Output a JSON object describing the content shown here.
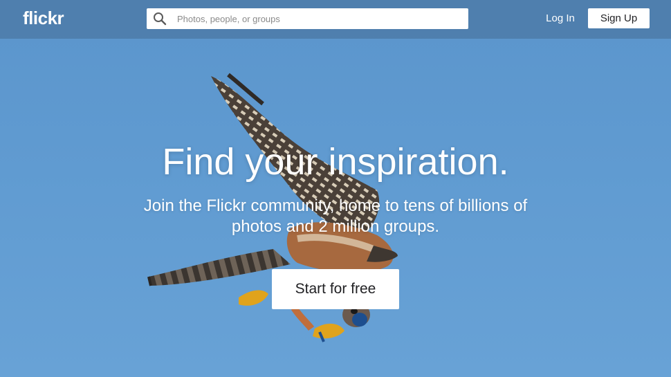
{
  "header": {
    "logo_text": "flickr",
    "search": {
      "icon": "search-icon",
      "placeholder": "Photos, people, or groups",
      "value": ""
    },
    "login_label": "Log In",
    "signup_label": "Sign Up"
  },
  "hero": {
    "image_subject": "kestrel-in-flight-image",
    "headline": "Find your inspiration.",
    "subheadline": "Join the Flickr community, home to tens of billions of photos and 2 million groups.",
    "cta_label": "Start for free"
  },
  "colors": {
    "sky_background": "#5f9ad0",
    "header_overlay": "#466e96",
    "button_background": "#ffffff",
    "button_text": "#212124",
    "text_on_hero": "#ffffff"
  }
}
